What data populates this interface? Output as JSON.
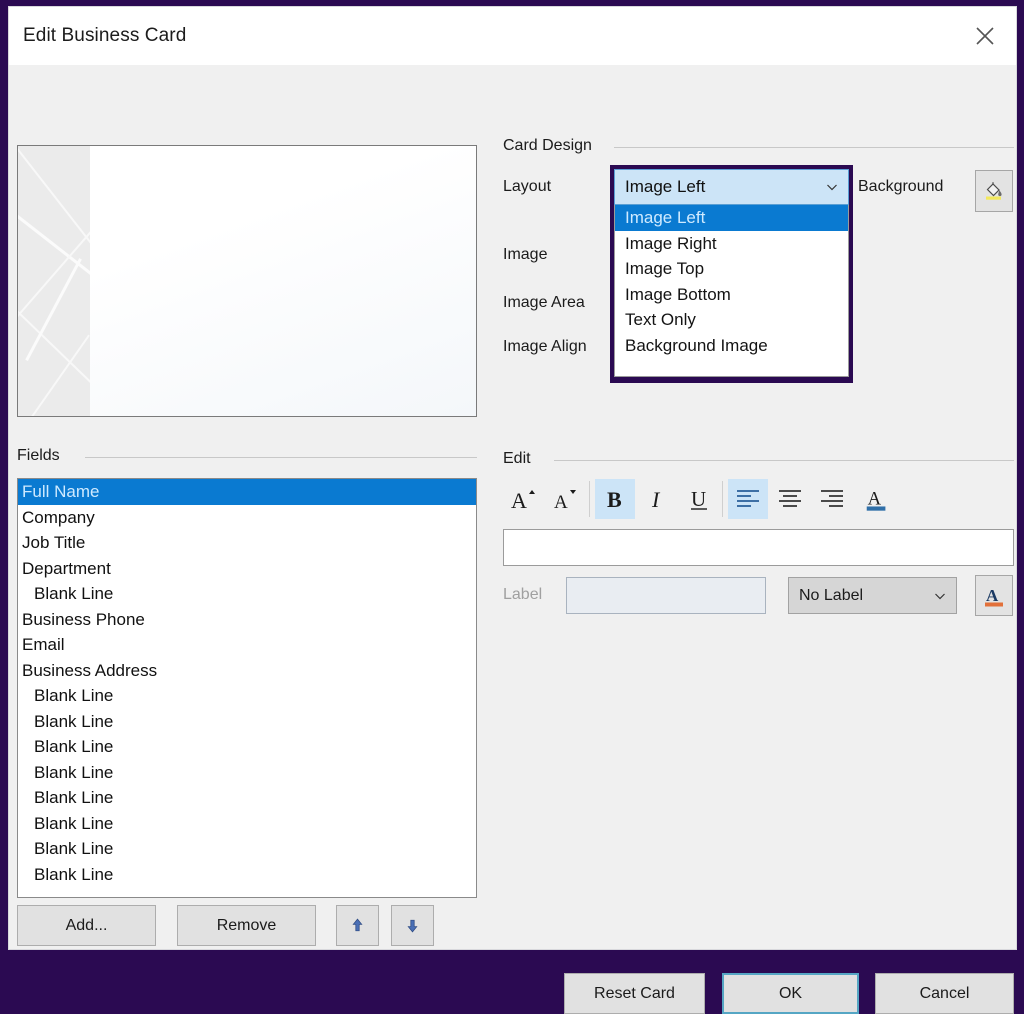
{
  "window": {
    "title": "Edit Business Card",
    "close_icon": "close-icon"
  },
  "preview": {
    "name": "card-preview"
  },
  "card_design": {
    "group_label": "Card Design",
    "labels": {
      "layout": "Layout",
      "image": "Image",
      "image_area": "Image Area",
      "image_align": "Image Align",
      "background": "Background"
    },
    "background_icon": "paint-bucket-icon",
    "layout_combo": {
      "value": "Image Left",
      "expanded": true,
      "chevron_icon": "chevron-down-icon",
      "options": [
        "Image Left",
        "Image Right",
        "Image Top",
        "Image Bottom",
        "Text Only",
        "Background Image"
      ],
      "selected_index": 0
    }
  },
  "fields": {
    "group_label": "Fields",
    "selected_index": 0,
    "items": [
      {
        "label": "Full Name",
        "indent": false
      },
      {
        "label": "Company",
        "indent": false
      },
      {
        "label": "Job Title",
        "indent": false
      },
      {
        "label": "Department",
        "indent": false
      },
      {
        "label": "Blank Line",
        "indent": true
      },
      {
        "label": "Business Phone",
        "indent": false
      },
      {
        "label": "Email",
        "indent": false
      },
      {
        "label": "Business Address",
        "indent": false
      },
      {
        "label": "Blank Line",
        "indent": true
      },
      {
        "label": "Blank Line",
        "indent": true
      },
      {
        "label": "Blank Line",
        "indent": true
      },
      {
        "label": "Blank Line",
        "indent": true
      },
      {
        "label": "Blank Line",
        "indent": true
      },
      {
        "label": "Blank Line",
        "indent": true
      },
      {
        "label": "Blank Line",
        "indent": true
      },
      {
        "label": "Blank Line",
        "indent": true
      }
    ],
    "buttons": {
      "add": "Add...",
      "remove": "Remove",
      "move_up_icon": "arrow-up-icon",
      "move_down_icon": "arrow-down-icon"
    }
  },
  "edit": {
    "group_label": "Edit",
    "toolbar": [
      {
        "name": "increase-font-size-icon",
        "glyph": "A",
        "active": false
      },
      {
        "name": "decrease-font-size-icon",
        "glyph": "A",
        "active": false
      },
      {
        "name": "bold-icon",
        "glyph": "B",
        "active": true
      },
      {
        "name": "italic-icon",
        "glyph": "I",
        "active": false
      },
      {
        "name": "underline-icon",
        "glyph": "U",
        "active": false
      },
      {
        "name": "align-left-icon",
        "glyph": "",
        "active": true
      },
      {
        "name": "align-center-icon",
        "glyph": "",
        "active": false
      },
      {
        "name": "align-right-icon",
        "glyph": "",
        "active": false
      },
      {
        "name": "font-color-icon",
        "glyph": "A",
        "active": false
      }
    ],
    "text_input": {
      "value": "",
      "placeholder": ""
    },
    "label_caption": "Label",
    "label_input": {
      "value": "",
      "placeholder": "",
      "disabled": true
    },
    "label_combo": {
      "value": "No Label",
      "chevron_icon": "chevron-down-icon"
    },
    "label_font_color_icon": "font-color-a-icon"
  },
  "footer": {
    "reset": "Reset Card",
    "ok": "OK",
    "cancel": "Cancel"
  },
  "colors": {
    "window_border": "#2b0a52",
    "accent_selection": "#0a7ad1",
    "toolbar_active": "#cce4f7",
    "focus_border": "#55a6c4"
  }
}
